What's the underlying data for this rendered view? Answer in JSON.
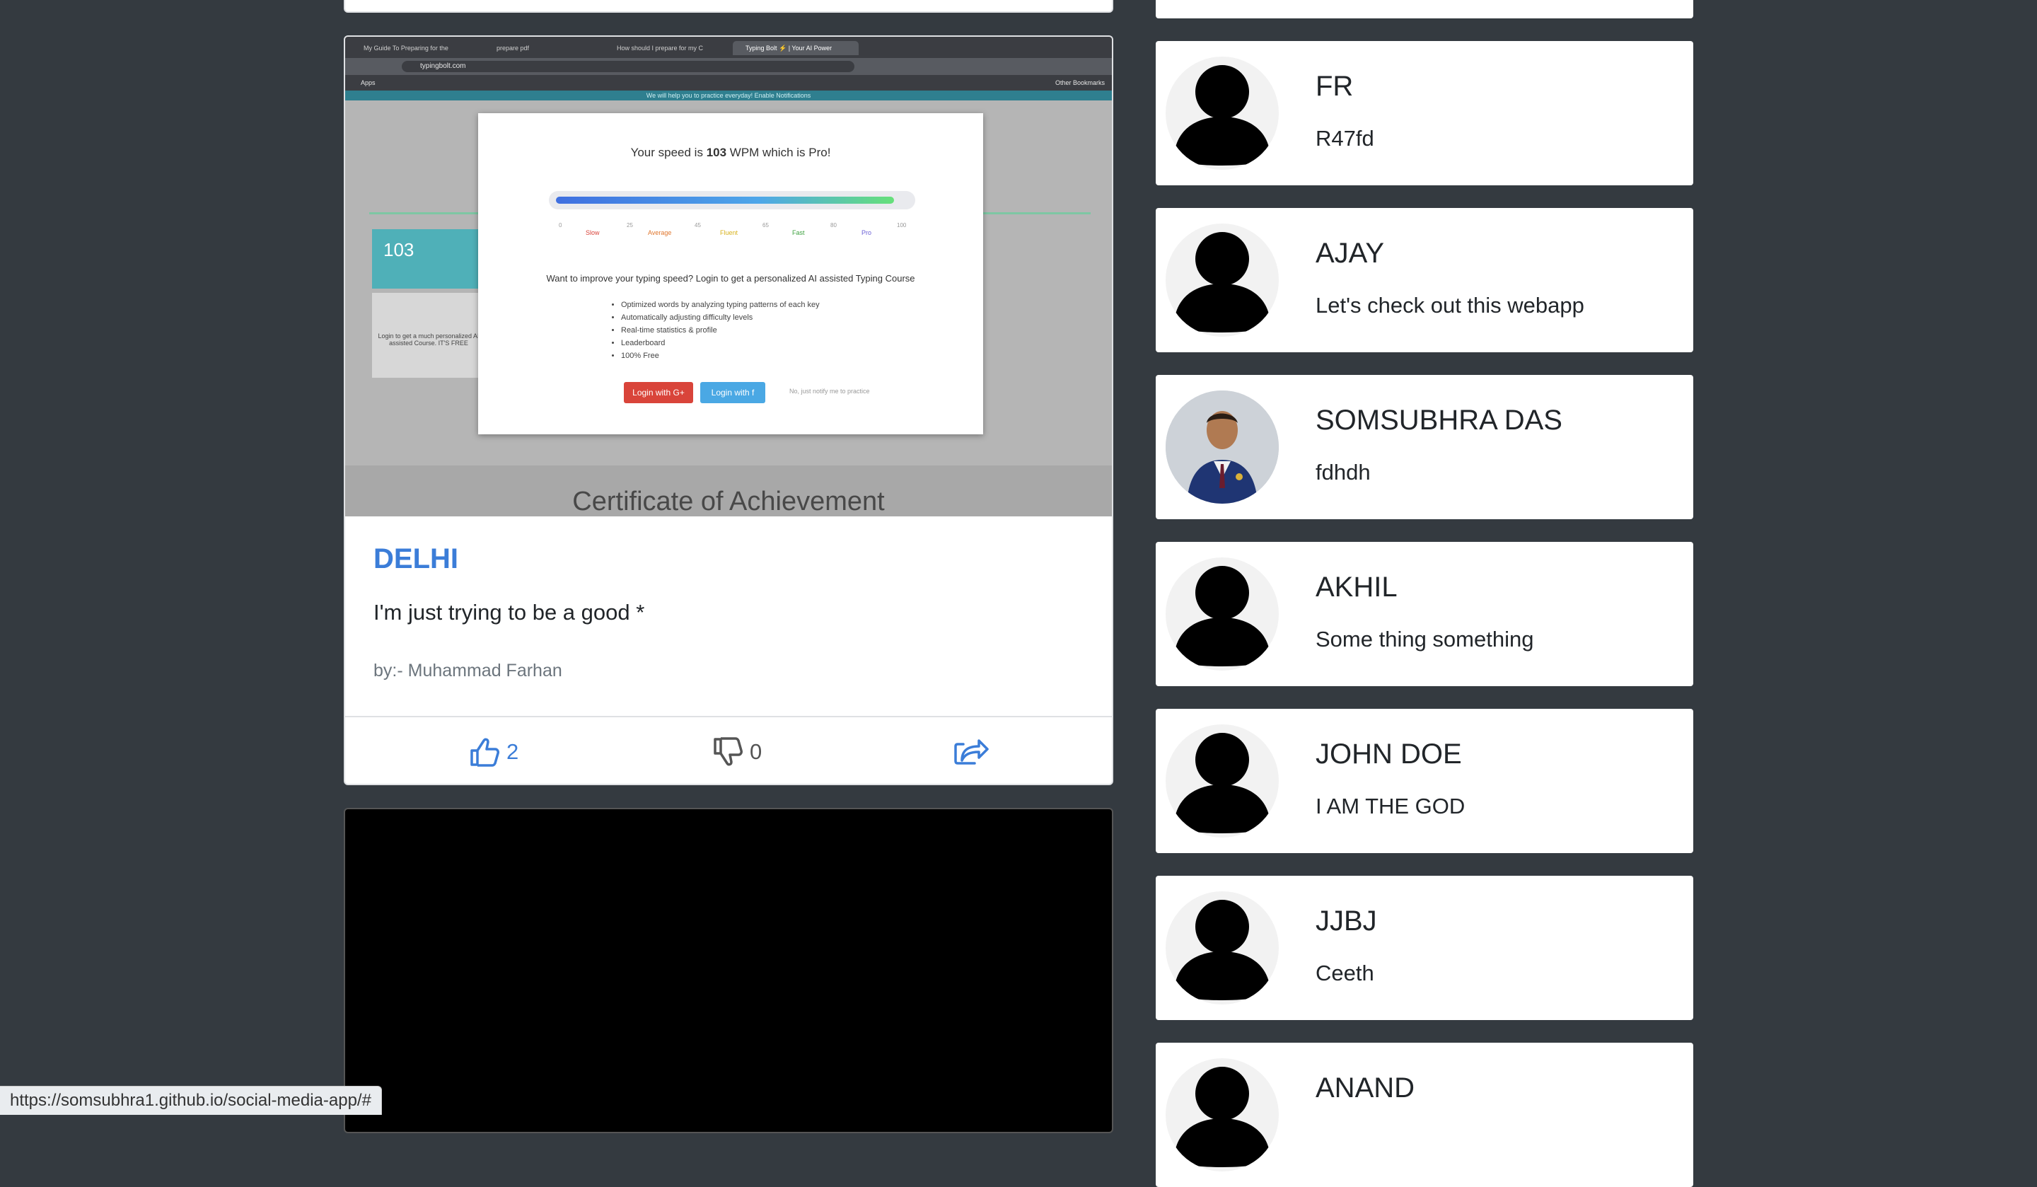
{
  "post": {
    "image": {
      "browser_tabs": [
        "My Guide To Preparing for the",
        "prepare pdf",
        "How should I prepare for my C",
        "Typing Bolt ⚡ | Your AI Power"
      ],
      "address": "typingbolt.com",
      "bookmarks_left": "Apps",
      "bookmarks_right": "Other Bookmarks",
      "notice": "We will help you to practice everyday! Enable Notifications",
      "bg_speed": "103",
      "bg_login_text": "Login to get a much personalized AI assisted Course. IT'S FREE",
      "modal": {
        "title_prefix": "Your speed is ",
        "title_speed": "103",
        "title_suffix": " WPM which is Pro!",
        "scale_labels": [
          "Slow",
          "Average",
          "Fluent",
          "Fast",
          "Pro"
        ],
        "scale_numbers": [
          "0",
          "25",
          "45",
          "65",
          "80",
          "100"
        ],
        "cta": "Want to improve your typing speed? Login to get a personalized AI assisted Typing Course",
        "features": [
          "Optimized words by analyzing typing patterns of each key",
          "Automatically adjusting difficulty levels",
          "Real-time statistics & profile",
          "Leaderboard",
          "100% Free"
        ],
        "google_button": "Login with G+",
        "facebook_button": "Login with f",
        "skip": "No, just notify me to practice"
      },
      "certificate": "Certificate of Achievement"
    },
    "title": "DELHI",
    "text": "I'm just trying to be a good *",
    "author": "by:- Muhammad Farhan",
    "likes": "2",
    "dislikes": "0"
  },
  "users": [
    {
      "name": "FR",
      "status": "R47fd",
      "avatar": "default-avatar"
    },
    {
      "name": "AJAY",
      "status": "Let's check out this webapp",
      "avatar": "default-avatar"
    },
    {
      "name": "SOMSUBHRA DAS",
      "status": "fdhdh",
      "avatar": "photo-avatar"
    },
    {
      "name": "AKHIL",
      "status": "Some thing something",
      "avatar": "default-avatar"
    },
    {
      "name": "JOHN DOE",
      "status": "I AM THE GOD",
      "avatar": "default-avatar"
    },
    {
      "name": "JJBJ",
      "status": "Ceeth",
      "avatar": "default-avatar"
    },
    {
      "name": "ANAND",
      "status": "",
      "avatar": "default-avatar"
    }
  ],
  "status_bar": {
    "url": "https://somsubhra1.github.io/social-media-app/#"
  },
  "colors": {
    "page_bg": "#343a40",
    "accent": "#3b7dd8",
    "card_bg": "#ffffff"
  }
}
